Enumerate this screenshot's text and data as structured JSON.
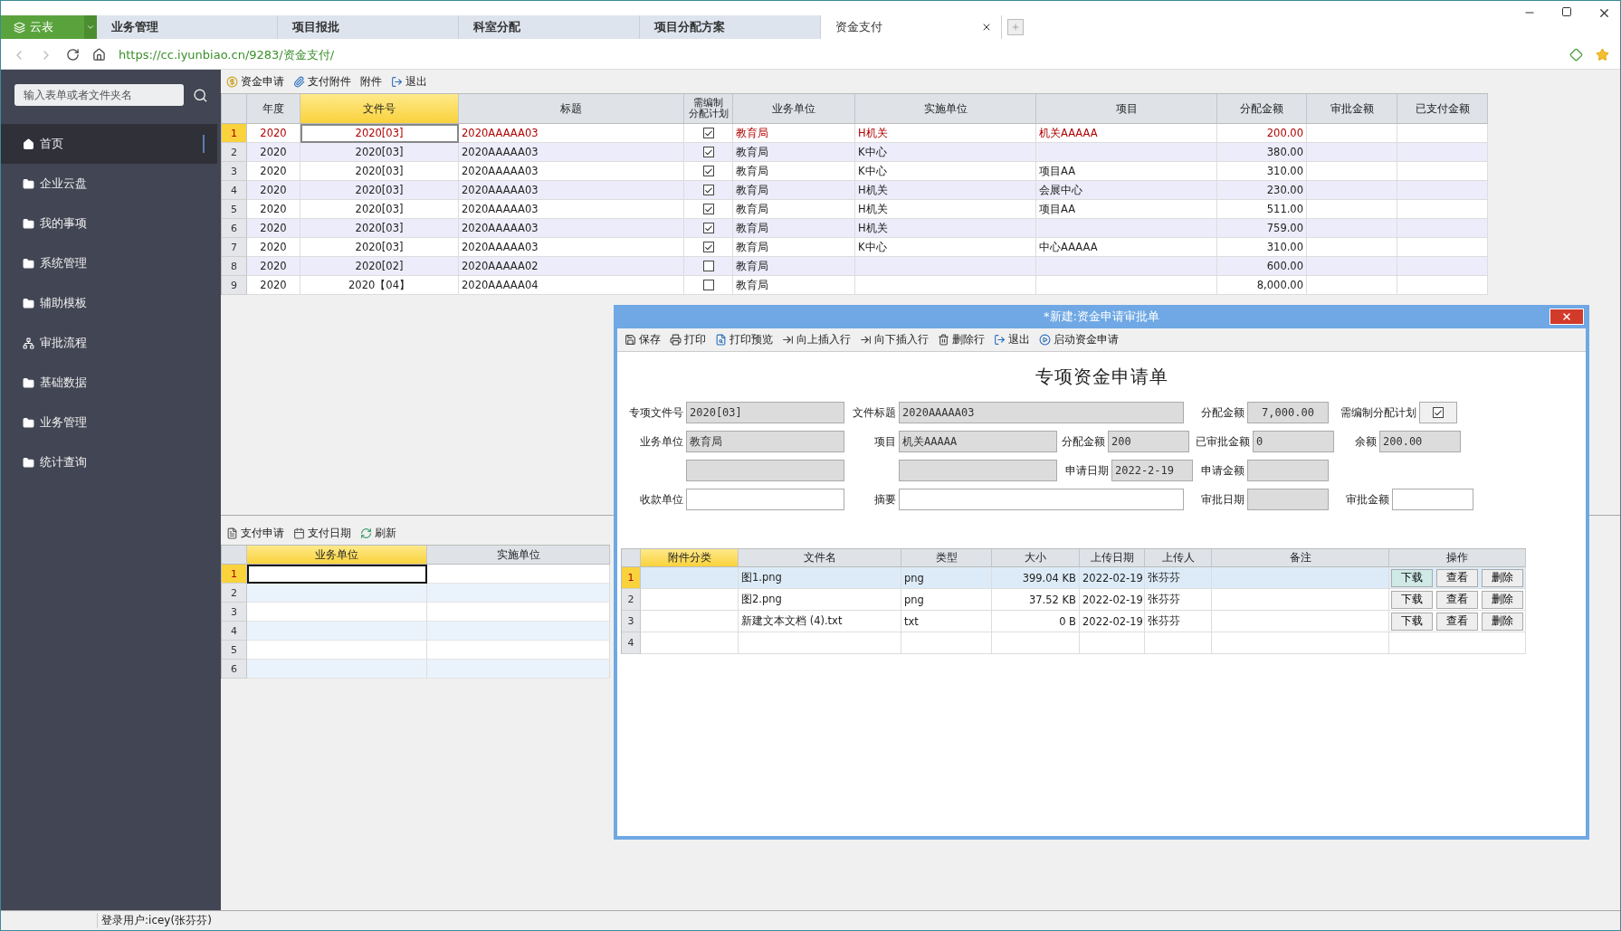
{
  "browser": {
    "app_tab": "云表",
    "tabs": [
      {
        "label": "业务管理",
        "selected": false
      },
      {
        "label": "项目报批",
        "selected": false
      },
      {
        "label": "科室分配",
        "selected": false
      },
      {
        "label": "项目分配方案",
        "selected": false
      },
      {
        "label": "资金支付",
        "selected": true
      }
    ],
    "url": "https://cc.iyunbiao.cn/9283/资金支付/"
  },
  "sidebar": {
    "search": {
      "placeholder": "输入表单或者文件夹名"
    },
    "items": [
      {
        "label": "首页",
        "kind": "home",
        "selected": true
      },
      {
        "label": "企业云盘",
        "kind": "folder",
        "selected": false
      },
      {
        "label": "我的事项",
        "kind": "folder",
        "selected": false
      },
      {
        "label": "系统管理",
        "kind": "folder",
        "selected": false
      },
      {
        "label": "辅助模板",
        "kind": "folder",
        "selected": false
      },
      {
        "label": "审批流程",
        "kind": "tree",
        "selected": false
      },
      {
        "label": "基础数据",
        "kind": "folder",
        "selected": false
      },
      {
        "label": "业务管理",
        "kind": "folder",
        "selected": false
      },
      {
        "label": "统计查询",
        "kind": "folder",
        "selected": false
      }
    ]
  },
  "toolbar": [
    {
      "label": "资金申请",
      "kind": "coin"
    },
    {
      "label": "支付附件",
      "kind": "clip"
    },
    {
      "label": "附件",
      "kind": "plain"
    },
    {
      "label": "退出",
      "kind": "exit"
    }
  ],
  "main_table": {
    "columns": [
      {
        "label": "年度",
        "selected": false
      },
      {
        "label": "文件号",
        "selected": true
      },
      {
        "label": "标题",
        "selected": false
      },
      {
        "label_lines": [
          "需编制",
          "分配计划"
        ],
        "selected": false
      },
      {
        "label": "业务单位",
        "selected": false
      },
      {
        "label": "实施单位",
        "selected": false
      },
      {
        "label": "项目",
        "selected": false
      },
      {
        "label": "分配金额",
        "selected": false
      },
      {
        "label": "审批金额",
        "selected": false
      },
      {
        "label": "已支付金额",
        "selected": false
      }
    ],
    "rows": [
      {
        "n": "1",
        "year": "2020",
        "doc": "2020[03]",
        "title": "2020AAAAA03",
        "plan": true,
        "unit": "教育局",
        "impl": "H机关",
        "project": "机关AAAAA",
        "amount": "200.00",
        "selected": true
      },
      {
        "n": "2",
        "year": "2020",
        "doc": "2020[03]",
        "title": "2020AAAAA03",
        "plan": true,
        "unit": "教育局",
        "impl": "K中心",
        "amount": "380.00",
        "selected": false
      },
      {
        "n": "3",
        "year": "2020",
        "doc": "2020[03]",
        "title": "2020AAAAA03",
        "plan": true,
        "unit": "教育局",
        "impl": "K中心",
        "project": "项目AA",
        "amount": "310.00",
        "selected": false
      },
      {
        "n": "4",
        "year": "2020",
        "doc": "2020[03]",
        "title": "2020AAAAA03",
        "plan": true,
        "unit": "教育局",
        "impl": "H机关",
        "project": "会展中心",
        "amount": "230.00",
        "selected": false
      },
      {
        "n": "5",
        "year": "2020",
        "doc": "2020[03]",
        "title": "2020AAAAA03",
        "plan": true,
        "unit": "教育局",
        "impl": "H机关",
        "project": "项目AA",
        "amount": "511.00",
        "selected": false
      },
      {
        "n": "6",
        "year": "2020",
        "doc": "2020[03]",
        "title": "2020AAAAA03",
        "plan": true,
        "unit": "教育局",
        "impl": "H机关",
        "amount": "759.00",
        "selected": false
      },
      {
        "n": "7",
        "year": "2020",
        "doc": "2020[03]",
        "title": "2020AAAAA03",
        "plan": true,
        "unit": "教育局",
        "impl": "K中心",
        "project": "中心AAAAA",
        "amount": "310.00",
        "selected": false
      },
      {
        "n": "8",
        "year": "2020",
        "doc": "2020[02]",
        "title": "2020AAAAA02",
        "plan": false,
        "unit": "教育局",
        "amount": "600.00",
        "selected": false
      },
      {
        "n": "9",
        "year": "2020",
        "doc": "2020【04】",
        "title": "2020AAAAA04",
        "plan": false,
        "unit": "教育局",
        "amount": "8,000.00",
        "selected": false
      }
    ]
  },
  "lower_panel": {
    "toolbar": [
      {
        "label": "支付申请",
        "kind": "doc"
      },
      {
        "label": "支付日期",
        "kind": "date"
      },
      {
        "label": "刷新",
        "kind": "refresh"
      }
    ],
    "columns": [
      {
        "label": "业务单位",
        "selected": true
      },
      {
        "label": "实施单位",
        "selected": false
      }
    ],
    "rows": [
      {
        "n": "1",
        "selected": true
      },
      {
        "n": "2",
        "selected": false
      },
      {
        "n": "3",
        "selected": false
      },
      {
        "n": "4",
        "selected": false
      },
      {
        "n": "5",
        "selected": false
      },
      {
        "n": "6",
        "selected": false
      }
    ]
  },
  "dialog": {
    "title": "*新建:资金申请审批单",
    "toolbar": [
      {
        "label": "保存",
        "kind": "save"
      },
      {
        "label": "打印",
        "kind": "print"
      },
      {
        "label": "打印预览",
        "kind": "preview"
      },
      {
        "label": "向上插入行",
        "kind": "insert"
      },
      {
        "label": "向下插入行",
        "kind": "insert"
      },
      {
        "label": "删除行",
        "kind": "delete"
      },
      {
        "label": "退出",
        "kind": "exit"
      },
      {
        "label": "启动资金申请",
        "kind": "start"
      }
    ],
    "form_title": "专项资金申请单",
    "form_rows": [
      [
        {
          "label": "专项文件号",
          "value": "2020[03]",
          "readonly": true,
          "kind": "text"
        },
        {
          "label": "文件标题",
          "value": "2020AAAAA03",
          "readonly": true,
          "kind": "text",
          "wide": true
        },
        {
          "label": "分配金额",
          "value": "7,000.00",
          "readonly": true,
          "kind": "number"
        },
        {
          "label": "需编制分配计划",
          "kind": "check",
          "checked": true
        }
      ],
      [
        {
          "label": "业务单位",
          "value": "教育局",
          "readonly": true,
          "kind": "text"
        },
        {
          "label": "项目",
          "value": "机关AAAAA",
          "readonly": true,
          "kind": "text"
        },
        {
          "label": "分配金额",
          "value": "200",
          "readonly": true,
          "kind": "text"
        },
        {
          "label": "已审批金额",
          "value": "0",
          "readonly": true,
          "kind": "text"
        },
        {
          "label": "余额",
          "value": "200.00",
          "readonly": true,
          "kind": "text"
        }
      ],
      [
        {
          "readonly": true,
          "kind": "text"
        },
        {
          "readonly": true,
          "kind": "text"
        },
        {
          "label": "申请日期",
          "value": "2022-2-19",
          "readonly": true,
          "kind": "text"
        },
        {
          "label": "申请金额",
          "readonly": true,
          "kind": "text"
        }
      ],
      [
        {
          "label": "收款单位",
          "readonly": false,
          "kind": "text"
        },
        {
          "label": "摘要",
          "readonly": false,
          "kind": "text",
          "wide": true
        },
        {
          "label": "审批日期",
          "readonly": true,
          "kind": "text"
        },
        {
          "label": "审批金额",
          "readonly": false,
          "kind": "text"
        }
      ]
    ],
    "attachments": {
      "columns": [
        {
          "label": "附件分类",
          "selected": true
        },
        {
          "label": "文件名",
          "selected": false
        },
        {
          "label": "类型",
          "selected": false
        },
        {
          "label": "大小",
          "selected": false
        },
        {
          "label": "上传日期",
          "selected": false
        },
        {
          "label": "上传人",
          "selected": false
        },
        {
          "label": "备注",
          "selected": false
        },
        {
          "label": "操作",
          "selected": false
        }
      ],
      "rows": [
        {
          "n": "1",
          "file": "图1.png",
          "type": "png",
          "size": "399.04 KB",
          "date": "2022-02-19",
          "user": "张芬芬",
          "actions": [
            "下载",
            "查看",
            "删除"
          ],
          "selected": true
        },
        {
          "n": "2",
          "file": "图2.png",
          "type": "png",
          "size": "37.52 KB",
          "date": "2022-02-19",
          "user": "张芬芬",
          "actions": [
            "下载",
            "查看",
            "删除"
          ],
          "selected": false
        },
        {
          "n": "3",
          "file": "新建文本文档 (4).txt",
          "type": "txt",
          "size": "0 B",
          "date": "2022-02-19",
          "user": "张芬芬",
          "actions": [
            "下载",
            "查看",
            "删除"
          ],
          "selected": false
        },
        {
          "n": "4",
          "selected": false
        }
      ]
    }
  },
  "status_bar": "登录用户:icey(张芬芬)"
}
